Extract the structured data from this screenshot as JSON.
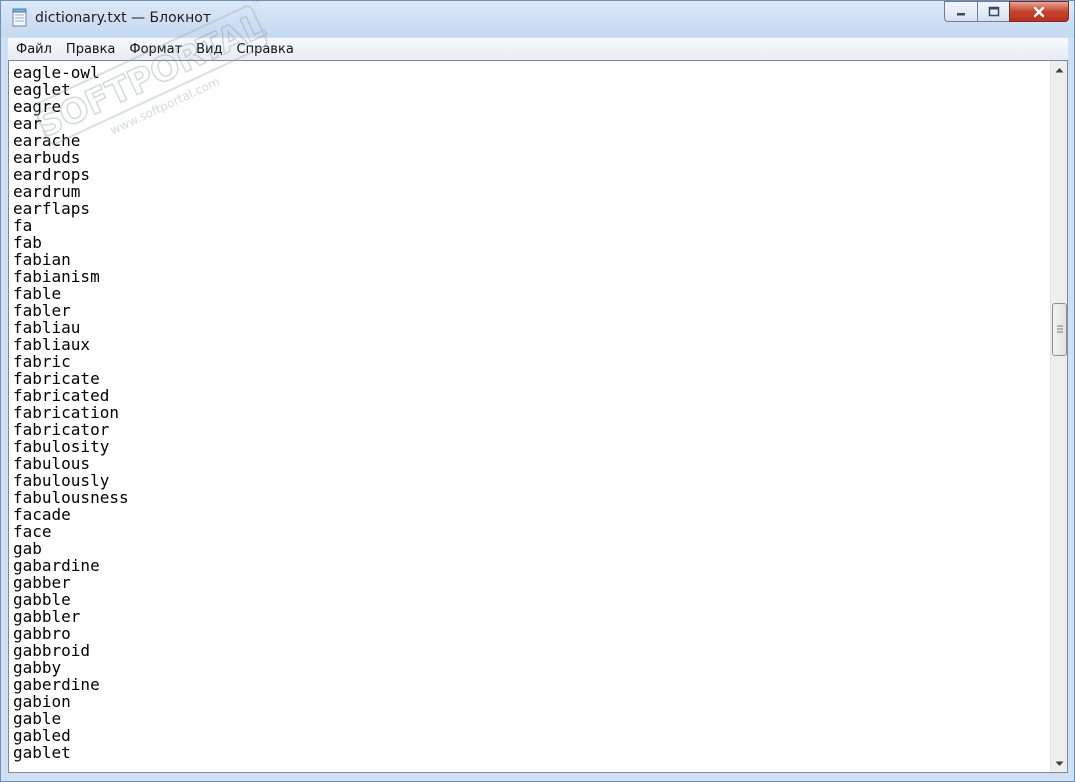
{
  "window": {
    "title": "dictionary.txt — Блокнот",
    "app_icon": "notepad-icon"
  },
  "caption_buttons": {
    "minimize_icon": "minimize-icon",
    "maximize_icon": "maximize-icon",
    "close_icon": "close-icon",
    "close_color": "#c7432d"
  },
  "menu": {
    "items": [
      "Файл",
      "Правка",
      "Формат",
      "Вид",
      "Справка"
    ]
  },
  "editor": {
    "lines": [
      "eagle-owl",
      "eaglet",
      "eagre",
      "ear",
      "earache",
      "earbuds",
      "eardrops",
      "eardrum",
      "earflaps",
      "fa",
      "fab",
      "fabian",
      "fabianism",
      "fable",
      "fabler",
      "fabliau",
      "fabliaux",
      "fabric",
      "fabricate",
      "fabricated",
      "fabrication",
      "fabricator",
      "fabulosity",
      "fabulous",
      "fabulously",
      "fabulousness",
      "facade",
      "face",
      "gab",
      "gabardine",
      "gabber",
      "gabble",
      "gabbler",
      "gabbro",
      "gabbroid",
      "gabby",
      "gaberdine",
      "gabion",
      "gable",
      "gabled",
      "gablet"
    ]
  },
  "scrollbar": {
    "up_icon": "scroll-up-arrow-icon",
    "down_icon": "scroll-down-arrow-icon",
    "position": 0.36
  },
  "watermark": {
    "brand": "SOFTPORTAL",
    "url": "www.softportal.com",
    "tm": "™"
  }
}
